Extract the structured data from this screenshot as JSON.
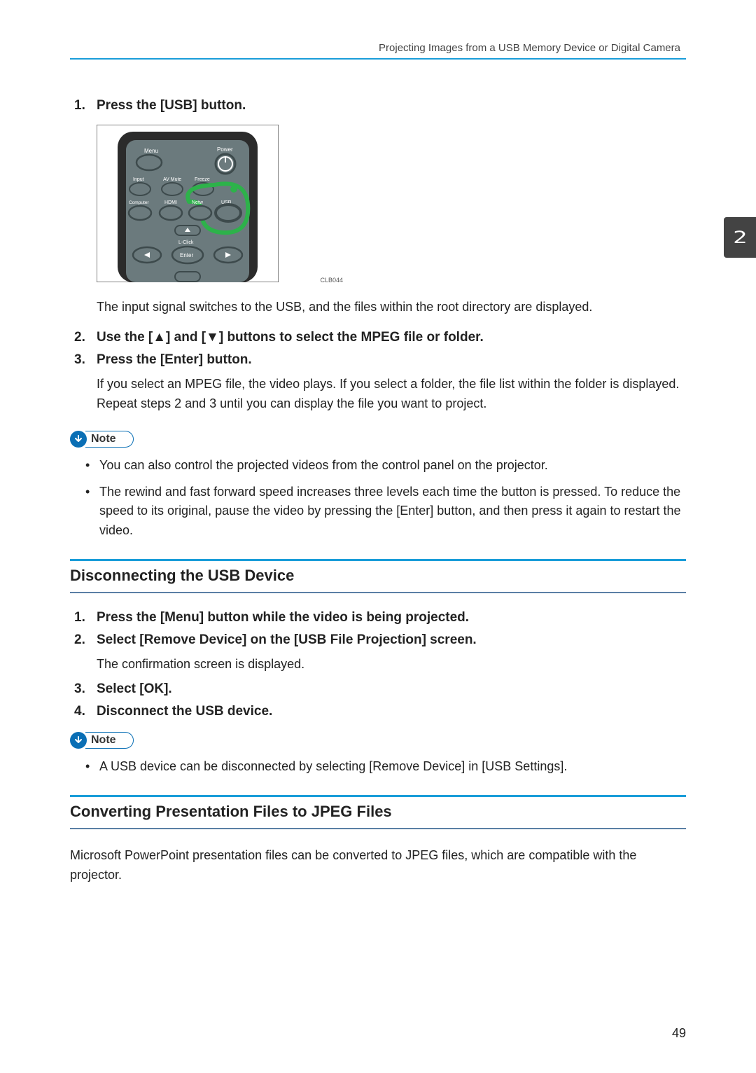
{
  "header": {
    "title": "Projecting Images from a USB Memory Device or Digital Camera"
  },
  "remote": {
    "menu": "Menu",
    "power": "Power",
    "input": "Input",
    "av_mute": "AV Mute",
    "freeze": "Freeze",
    "computer": "Computer",
    "hdmi": "HDMI",
    "netw": "Netw",
    "usb": "USB",
    "lclick": "L-Click",
    "enter": "Enter",
    "caption": "CLB044"
  },
  "steps1": [
    {
      "num": "1.",
      "title": "Press the [USB] button.",
      "after": "The input signal switches to the USB, and the files within the root directory are displayed."
    },
    {
      "num": "2.",
      "title": "Use the [▲] and [▼] buttons to select the MPEG file or folder."
    },
    {
      "num": "3.",
      "title": "Press the [Enter] button.",
      "text": "If you select an MPEG file, the video plays. If you select a folder, the file list within the folder is displayed. Repeat steps 2 and 3 until you can display the file you want to project."
    }
  ],
  "note_label": "Note",
  "notes1": [
    "You can also control the projected videos from the control panel on the projector.",
    "The rewind and fast forward speed increases three levels each time the button is pressed. To reduce the speed to its original, pause the video by pressing the [Enter] button, and then press it again to restart the video."
  ],
  "section2": {
    "title": "Disconnecting the USB Device"
  },
  "steps2": [
    {
      "num": "1.",
      "title": "Press the [Menu] button while the video is being projected."
    },
    {
      "num": "2.",
      "title": "Select [Remove Device] on the [USB File Projection] screen.",
      "text": "The confirmation screen is displayed."
    },
    {
      "num": "3.",
      "title": "Select [OK]."
    },
    {
      "num": "4.",
      "title": "Disconnect the USB device."
    }
  ],
  "notes2": [
    "A USB device can be disconnected by selecting [Remove Device] in [USB Settings]."
  ],
  "section3": {
    "title": "Converting Presentation Files to JPEG Files",
    "intro": "Microsoft PowerPoint presentation files can be converted to JPEG files, which are compatible with the projector."
  },
  "page_number": "49",
  "side_tab": "2"
}
